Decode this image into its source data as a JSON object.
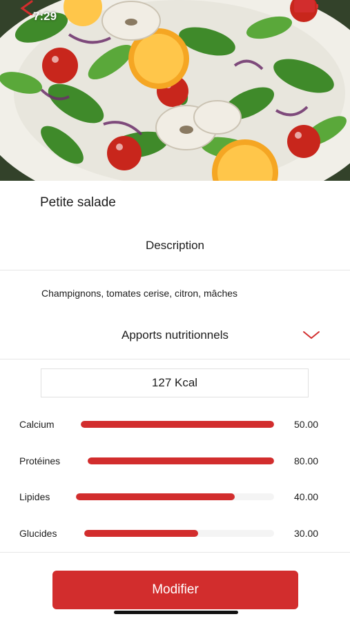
{
  "status_bar": {
    "time": "7:29"
  },
  "dish": {
    "title": "Petite salade",
    "description_header": "Description",
    "description": "Champignons, tomates cerise, citron, mâches",
    "nutrition_header": "Apports nutritionnels",
    "calories": "127 Kcal"
  },
  "nutrients": [
    {
      "label": "Calcium",
      "value": "50.00",
      "fill_fraction": 1.0
    },
    {
      "label": "Protéines",
      "value": "80.00",
      "fill_fraction": 1.0
    },
    {
      "label": "Lipides",
      "value": "40.00",
      "fill_fraction": 0.8
    },
    {
      "label": "Glucides",
      "value": "30.00",
      "fill_fraction": 0.6
    }
  ],
  "actions": {
    "modify_label": "Modifier"
  },
  "colors": {
    "accent": "#d22d2d",
    "divider": "#e6e6e6"
  },
  "icons": {
    "back": "back-arrow-icon",
    "expand": "chevron-down-icon",
    "battery": "battery-icon"
  }
}
